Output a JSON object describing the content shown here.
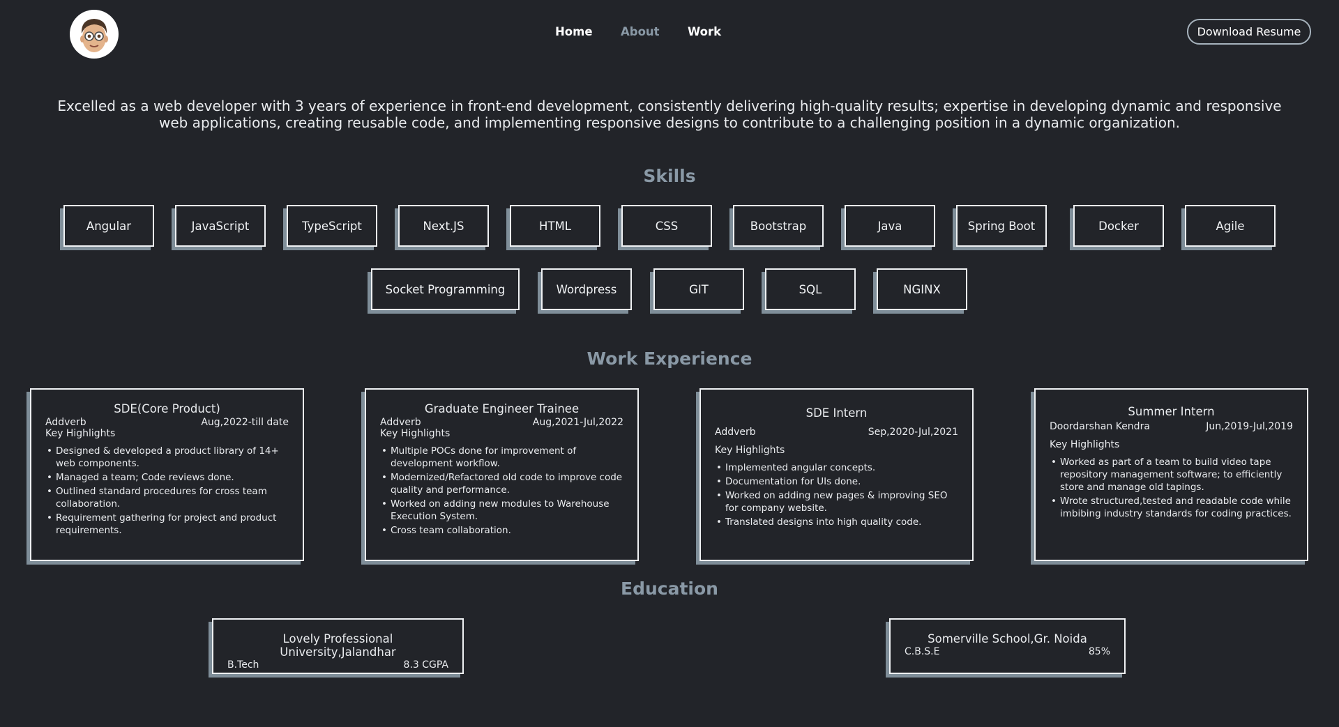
{
  "nav": {
    "home": "Home",
    "about": "About",
    "work": "Work",
    "resume_button": "Download Resume"
  },
  "summary": "Excelled as a web developer with 3 years of experience in front-end development, consistently delivering high-quality results; expertise in developing dynamic and responsive web applications, creating reusable code, and implementing responsive designs to contribute to a challenging position in a dynamic organization.",
  "skills": {
    "title": "Skills",
    "items": [
      "Angular",
      "JavaScript",
      "TypeScript",
      "Next.JS",
      "HTML",
      "CSS",
      "Bootstrap",
      "Java",
      "Spring Boot",
      "Docker",
      "Agile",
      "Socket Programming",
      "Wordpress",
      "GIT",
      "SQL",
      "NGINX"
    ]
  },
  "work": {
    "title": "Work Experience",
    "key_highlights": "Key Highlights",
    "jobs": [
      {
        "role": "SDE(Core Product)",
        "company": "Addverb",
        "period": "Aug,2022-till date",
        "points": [
          "Designed & developed a product library of 14+ web components.",
          "Managed a team; Code reviews done.",
          "Outlined standard procedures for cross team collaboration.",
          "Requirement gathering for project and product requirements."
        ]
      },
      {
        "role": "Graduate Engineer Trainee",
        "company": "Addverb",
        "period": "Aug,2021-Jul,2022",
        "points": [
          "Multiple POCs done for improvement of development workflow.",
          "Modernized/Refactored old code to improve code quality and performance.",
          "Worked on adding new modules to Warehouse Execution System.",
          "Cross team collaboration."
        ]
      },
      {
        "role": "SDE Intern",
        "company": "Addverb",
        "period": "Sep,2020-Jul,2021",
        "points": [
          "Implemented angular concepts.",
          "Documentation for UIs done.",
          "Worked on adding new pages & improving SEO for company website.",
          "Translated designs into high quality code."
        ]
      },
      {
        "role": "Summer Intern",
        "company": "Doordarshan Kendra",
        "period": "Jun,2019-Jul,2019",
        "points": [
          "Worked as part of a team to build video tape repository management software; to efficiently store and manage old tapings.",
          "Wrote structured,tested and readable code while imbibing industry standards for coding practices."
        ]
      }
    ]
  },
  "education": {
    "title": "Education",
    "items": [
      {
        "name": "Lovely Professional University,Jalandhar",
        "degree": "B.Tech",
        "score": "8.3 CGPA"
      },
      {
        "name": "Somerville School,Gr. Noida",
        "degree": "C.B.S.E",
        "score": "85%"
      }
    ]
  },
  "colors": {
    "background": "#222429",
    "accent": "#8a99a6",
    "border": "#f0f2f4",
    "shadow": "#7f8e99"
  }
}
